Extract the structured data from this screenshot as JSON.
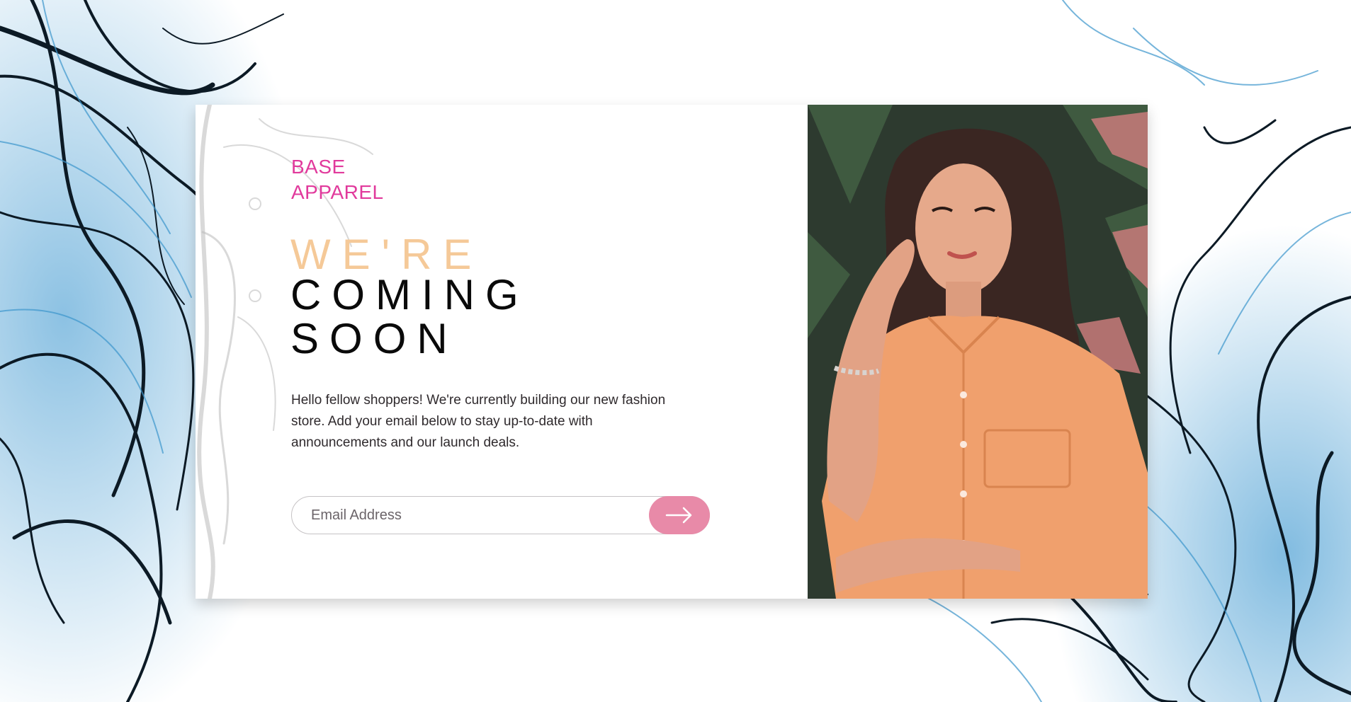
{
  "brand": {
    "line1": "BASE",
    "line2": "APPAREL"
  },
  "headline": {
    "light": "WE'RE",
    "dark_line1": "COMING",
    "dark_line2": "SOON"
  },
  "description": "Hello fellow shoppers! We're currently building our new fashion store. Add your email below to stay up-to-date with announcements and our launch deals.",
  "form": {
    "email_placeholder": "Email Address",
    "email_value": ""
  },
  "icons": {
    "submit": "arrow-right-icon"
  },
  "colors": {
    "brand": "#e13a9c",
    "headline_light": "#f5c998",
    "headline_dark": "#0a0a0a",
    "button": "#e88aa8",
    "background_strands": "#2f86c0"
  }
}
